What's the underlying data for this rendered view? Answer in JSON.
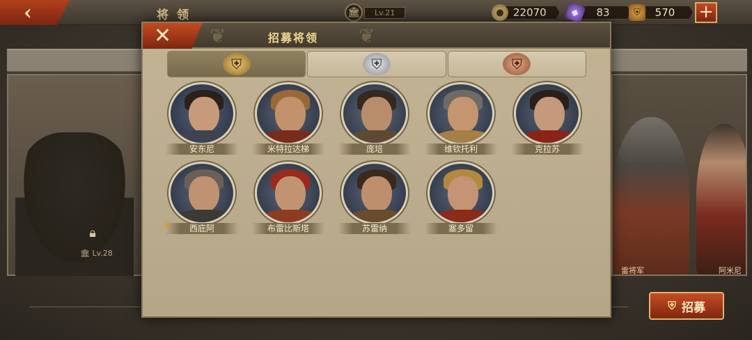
{
  "top_bar": {
    "back_icon": "back-arrow-icon",
    "title": "将 领",
    "level": "Lv.21",
    "coins": "22070",
    "gems": "83",
    "helmets": "570",
    "plus_label": "+"
  },
  "left_panel": {
    "level": "Lv.28"
  },
  "right_panel": {
    "name_1": "雷将军",
    "name_2": "阿米尼"
  },
  "recruit_button": {
    "label": "招募"
  },
  "modal": {
    "title": "招募将领",
    "close_label": "✕",
    "tabs": [
      {
        "tier": "gold",
        "icon": "gold-helmet-icon"
      },
      {
        "tier": "silver",
        "icon": "silver-helmet-icon"
      },
      {
        "tier": "bronze",
        "icon": "bronze-helmet-icon"
      }
    ],
    "heroes": [
      {
        "name": "安东尼"
      },
      {
        "name": "米特拉达梯"
      },
      {
        "name": "庞培"
      },
      {
        "name": "维钦托利"
      },
      {
        "name": "克拉苏"
      },
      {
        "name": "西庇阿"
      },
      {
        "name": "布雷比斯塔"
      },
      {
        "name": "苏雷纳"
      },
      {
        "name": "塞多留"
      }
    ]
  },
  "colors": {
    "accent_red": "#b2401c",
    "gold_text": "#f0d78f",
    "panel_parchment": "#b5a687"
  }
}
